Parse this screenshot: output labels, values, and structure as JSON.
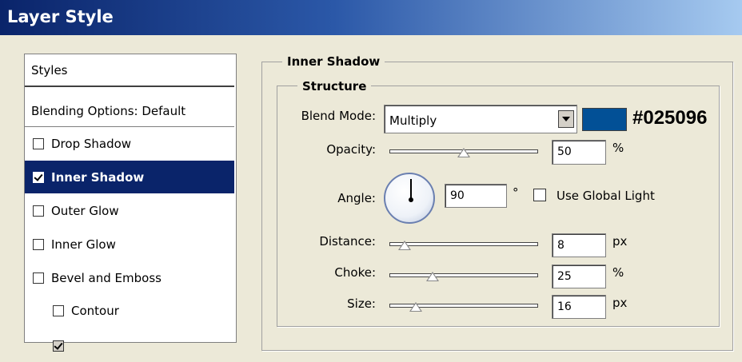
{
  "window": {
    "title": "Layer Style"
  },
  "sidebar": {
    "header": "Styles",
    "items": [
      {
        "label": "Blending Options: Default",
        "checkbox": false,
        "checked": false,
        "selected": false,
        "indent": false
      },
      {
        "label": "Drop Shadow",
        "checkbox": true,
        "checked": false,
        "selected": false,
        "indent": false
      },
      {
        "label": "Inner Shadow",
        "checkbox": true,
        "checked": true,
        "selected": true,
        "indent": false
      },
      {
        "label": "Outer Glow",
        "checkbox": true,
        "checked": false,
        "selected": false,
        "indent": false
      },
      {
        "label": "Inner Glow",
        "checkbox": true,
        "checked": false,
        "selected": false,
        "indent": false
      },
      {
        "label": "Bevel and Emboss",
        "checkbox": true,
        "checked": false,
        "selected": false,
        "indent": false
      },
      {
        "label": "Contour",
        "checkbox": true,
        "checked": false,
        "selected": false,
        "indent": true
      }
    ]
  },
  "panel": {
    "title": "Inner Shadow",
    "structure_title": "Structure",
    "blend_mode": {
      "label": "Blend Mode:",
      "value": "Multiply"
    },
    "color": {
      "hex_label": "#025096",
      "swatch": "#025096"
    },
    "opacity": {
      "label": "Opacity:",
      "value": "50",
      "unit": "%",
      "level": 0.5
    },
    "angle": {
      "label": "Angle:",
      "value": "90",
      "unit": "°",
      "global_light_label": "Use Global Light",
      "global_light_checked": false
    },
    "distance": {
      "label": "Distance:",
      "value": "8",
      "unit": "px",
      "level": 0.03
    },
    "choke": {
      "label": "Choke:",
      "value": "25",
      "unit": "%",
      "level": 0.25
    },
    "size": {
      "label": "Size:",
      "value": "16",
      "unit": "px",
      "level": 0.12
    }
  },
  "colors": {
    "selection": "#0a246a",
    "dialog_bg": "#ece9d8"
  }
}
